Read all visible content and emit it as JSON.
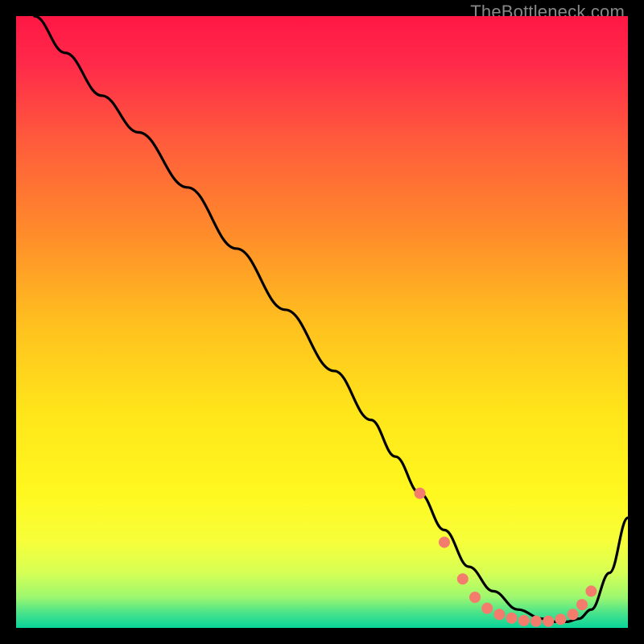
{
  "watermark": "TheBottleneck.com",
  "chart_data": {
    "type": "line",
    "title": "",
    "xlabel": "",
    "ylabel": "",
    "xlim": [
      0,
      100
    ],
    "ylim": [
      0,
      100
    ],
    "background_gradient": {
      "stops": [
        {
          "offset": 0.0,
          "color": "#ff1744"
        },
        {
          "offset": 0.08,
          "color": "#ff2a4a"
        },
        {
          "offset": 0.2,
          "color": "#ff5a3c"
        },
        {
          "offset": 0.35,
          "color": "#ff8a2b"
        },
        {
          "offset": 0.5,
          "color": "#ffbf1f"
        },
        {
          "offset": 0.65,
          "color": "#ffe61a"
        },
        {
          "offset": 0.78,
          "color": "#fff81f"
        },
        {
          "offset": 0.86,
          "color": "#f6ff3a"
        },
        {
          "offset": 0.91,
          "color": "#d6ff55"
        },
        {
          "offset": 0.95,
          "color": "#9cf76f"
        },
        {
          "offset": 0.975,
          "color": "#4be38a"
        },
        {
          "offset": 1.0,
          "color": "#08d49a"
        }
      ]
    },
    "series": [
      {
        "name": "bottleneck-curve",
        "stroke": "#000000",
        "x": [
          3,
          8,
          14,
          20,
          28,
          36,
          44,
          52,
          58,
          62,
          66,
          70,
          74,
          78,
          82,
          86,
          88,
          90,
          92,
          94,
          97,
          100
        ],
        "y": [
          100,
          94,
          87,
          81,
          72,
          62,
          52,
          42,
          34,
          28,
          22,
          16,
          10,
          6,
          3,
          1.5,
          1,
          1,
          1.5,
          3,
          9,
          18
        ]
      }
    ],
    "markers": {
      "color": "#f47c6c",
      "radius": 7,
      "points": [
        {
          "x": 66,
          "y": 22
        },
        {
          "x": 70,
          "y": 14
        },
        {
          "x": 73,
          "y": 8
        },
        {
          "x": 75,
          "y": 5
        },
        {
          "x": 77,
          "y": 3.2
        },
        {
          "x": 79,
          "y": 2.2
        },
        {
          "x": 81,
          "y": 1.6
        },
        {
          "x": 83,
          "y": 1.2
        },
        {
          "x": 85,
          "y": 1.1
        },
        {
          "x": 87,
          "y": 1.1
        },
        {
          "x": 89,
          "y": 1.4
        },
        {
          "x": 91,
          "y": 2.2
        },
        {
          "x": 92.5,
          "y": 3.8
        },
        {
          "x": 94,
          "y": 6
        }
      ]
    }
  }
}
